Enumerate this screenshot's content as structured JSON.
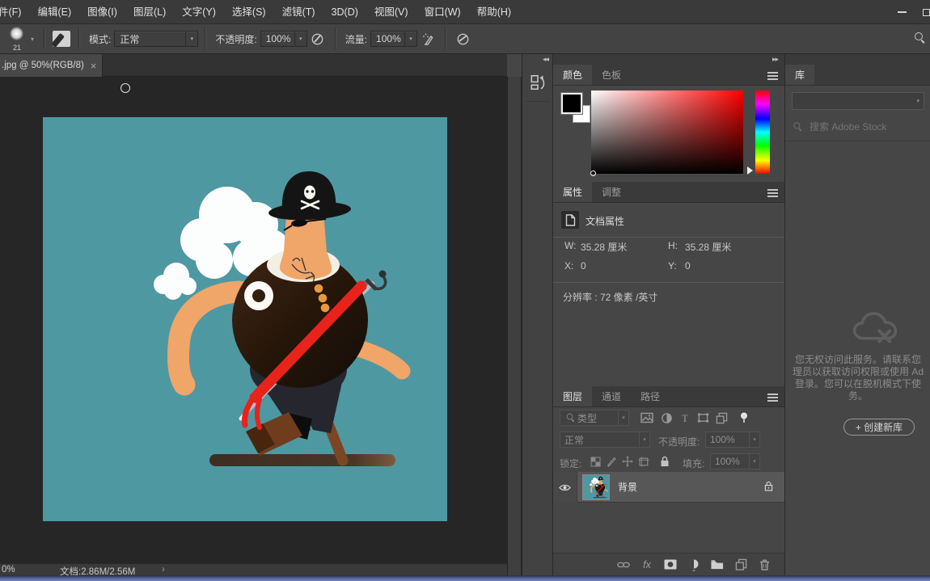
{
  "menu": {
    "items": [
      "件(F)",
      "编辑(E)",
      "图像(I)",
      "图层(L)",
      "文字(Y)",
      "选择(S)",
      "滤镜(T)",
      "3D(D)",
      "视图(V)",
      "窗口(W)",
      "帮助(H)"
    ]
  },
  "options": {
    "brush_size": "21",
    "mode_label": "模式:",
    "mode_value": "正常",
    "opacity_label": "不透明度:",
    "opacity_value": "100%",
    "flow_label": "流量:",
    "flow_value": "100%"
  },
  "doc_tab": {
    "title": ".jpg @ 50%(RGB/8)",
    "close": "×"
  },
  "color_panel": {
    "tab_color": "颜色",
    "tab_swatches": "色板"
  },
  "properties_panel": {
    "tab_properties": "属性",
    "tab_adjust": "调整",
    "doc_props": "文档属性",
    "w_label": "W:",
    "w_value": "35.28 厘米",
    "h_label": "H:",
    "h_value": "35.28 厘米",
    "x_label": "X:",
    "x_value": "0",
    "y_label": "Y:",
    "y_value": "0",
    "resolution": "分辨率 : 72 像素 /英寸"
  },
  "layers_panel": {
    "tab_layers": "图层",
    "tab_channels": "通道",
    "tab_paths": "路径",
    "filter_label": "类型",
    "blend_mode": "正常",
    "opacity_label": "不透明度:",
    "opacity_value": "100%",
    "lock_label": "锁定:",
    "fill_label": "填充:",
    "fill_value": "100%",
    "layer_name": "背景",
    "fx_label": "fx"
  },
  "libraries_panel": {
    "tab": "库",
    "search_placeholder": "搜索 Adobe Stock",
    "message_lines": [
      "您无权访问此服务。请联系您",
      "理员以获取访问权限或使用 Ad",
      "登录。您可以在脱机模式下使",
      "务。"
    ],
    "create_button": "+ 创建新库"
  },
  "status_bar": {
    "zoom": "0%",
    "doc_label": "文档:2.86M/2.56M",
    "chevron": "›"
  },
  "canvas": {
    "background_teal": "#4E98A2",
    "skin": "#F0A569",
    "sash_red": "#E7231B"
  }
}
